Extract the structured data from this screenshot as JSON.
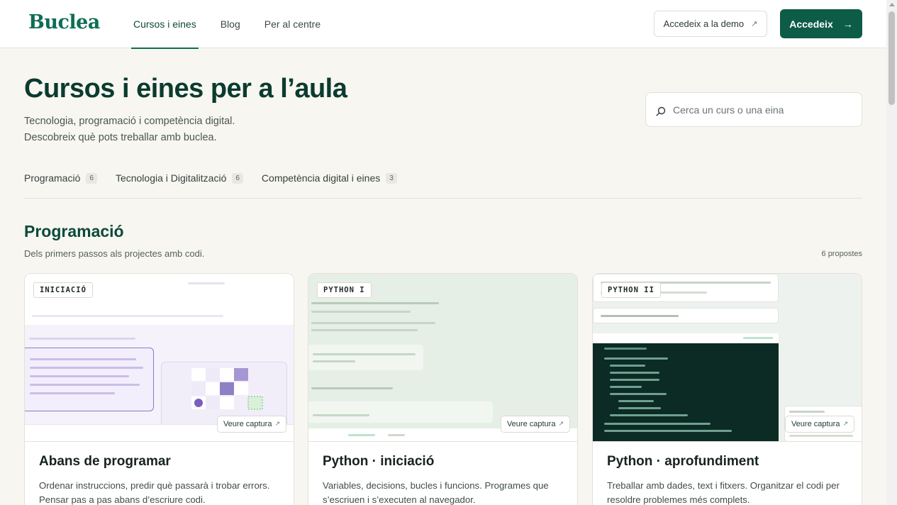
{
  "header": {
    "logo": "Buclea",
    "nav": [
      "Cursos i eines",
      "Blog",
      "Per al centre"
    ],
    "demo_label": "Accedeix a la demo",
    "demo_arrow": "↗",
    "login_label": "Accedeix",
    "login_arrow": "→"
  },
  "hero": {
    "title": "Cursos i eines per a l’aula",
    "subtitle_line1": "Tecnologia, programació i competència digital.",
    "subtitle_line2": "Descobreix què pots treballar amb buclea.",
    "search_placeholder": "Cerca un curs o una eina"
  },
  "filters": [
    {
      "label": "Programació",
      "count": "6"
    },
    {
      "label": "Tecnologia i Digitalització",
      "count": "6"
    },
    {
      "label": "Competència digital i eines",
      "count": "3"
    }
  ],
  "section": {
    "title": "Programació",
    "subtitle": "Dels primers passos als projectes amb codi.",
    "count": "6 propostes"
  },
  "cards": [
    {
      "level": "INICIACIÓ",
      "capture_label": "Veure captura",
      "capture_arrow": "↗",
      "title": "Abans de programar",
      "description": "Ordenar instruccions, predir què passarà i trobar errors. Pensar pas a pas abans d’escriure codi."
    },
    {
      "level": "PYTHON I",
      "capture_label": "Veure captura",
      "capture_arrow": "↗",
      "title": "Python · iniciació",
      "description": "Variables, decisions, bucles i funcions. Programes que s’escriuen i s’executen al navegador."
    },
    {
      "level": "PYTHON II",
      "capture_label": "Veure captura",
      "capture_arrow": "↗",
      "title": "Python · aprofundiment",
      "description": "Treballar amb dades, text i fitxers. Organitzar el codi per resoldre problemes més complets."
    }
  ],
  "colors": {
    "brand": "#0d6e55",
    "brand_dark": "#0d5c48",
    "title": "#0b3b2f",
    "background": "#f8f6f1"
  }
}
